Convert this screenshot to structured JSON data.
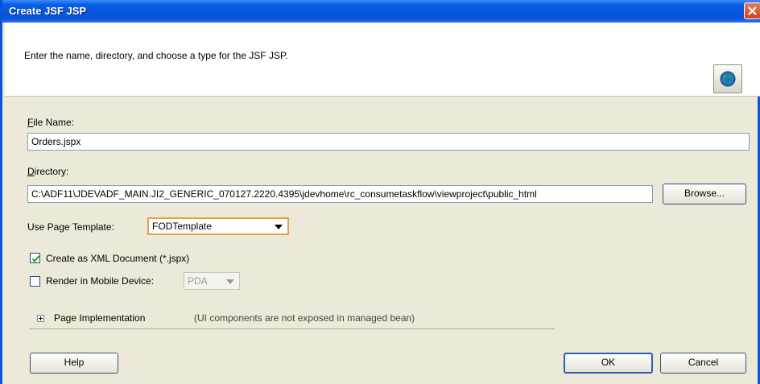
{
  "window": {
    "title": "Create JSF JSP"
  },
  "header": {
    "message": "Enter the name, directory, and choose a type for the JSF JSP."
  },
  "form": {
    "file_name_label": "File Name:",
    "file_name_value": "Orders.jspx",
    "directory_label": "Directory:",
    "directory_value": "C:\\ADF11\\JDEVADF_MAIN.JI2_GENERIC_070127.2220.4395\\jdevhome\\rc_consumetaskflow\\viewproject\\public_html",
    "browse_label": "Browse...",
    "template_label": "Use Page Template:",
    "template_value": "FODTemplate",
    "xml_doc_label": "Create as XML Document (*.jspx)",
    "xml_doc_checked": true,
    "mobile_label": "Render in Mobile Device:",
    "mobile_checked": false,
    "mobile_value": "PDA",
    "page_impl_label": "Page Implementation",
    "page_impl_hint": "(UI components are not exposed in managed bean)"
  },
  "buttons": {
    "help": "Help",
    "ok": "OK",
    "cancel": "Cancel"
  },
  "colors": {
    "titlebar": "#0a5fe8",
    "dialog_bg": "#ece9d8",
    "close": "#d2421b"
  }
}
